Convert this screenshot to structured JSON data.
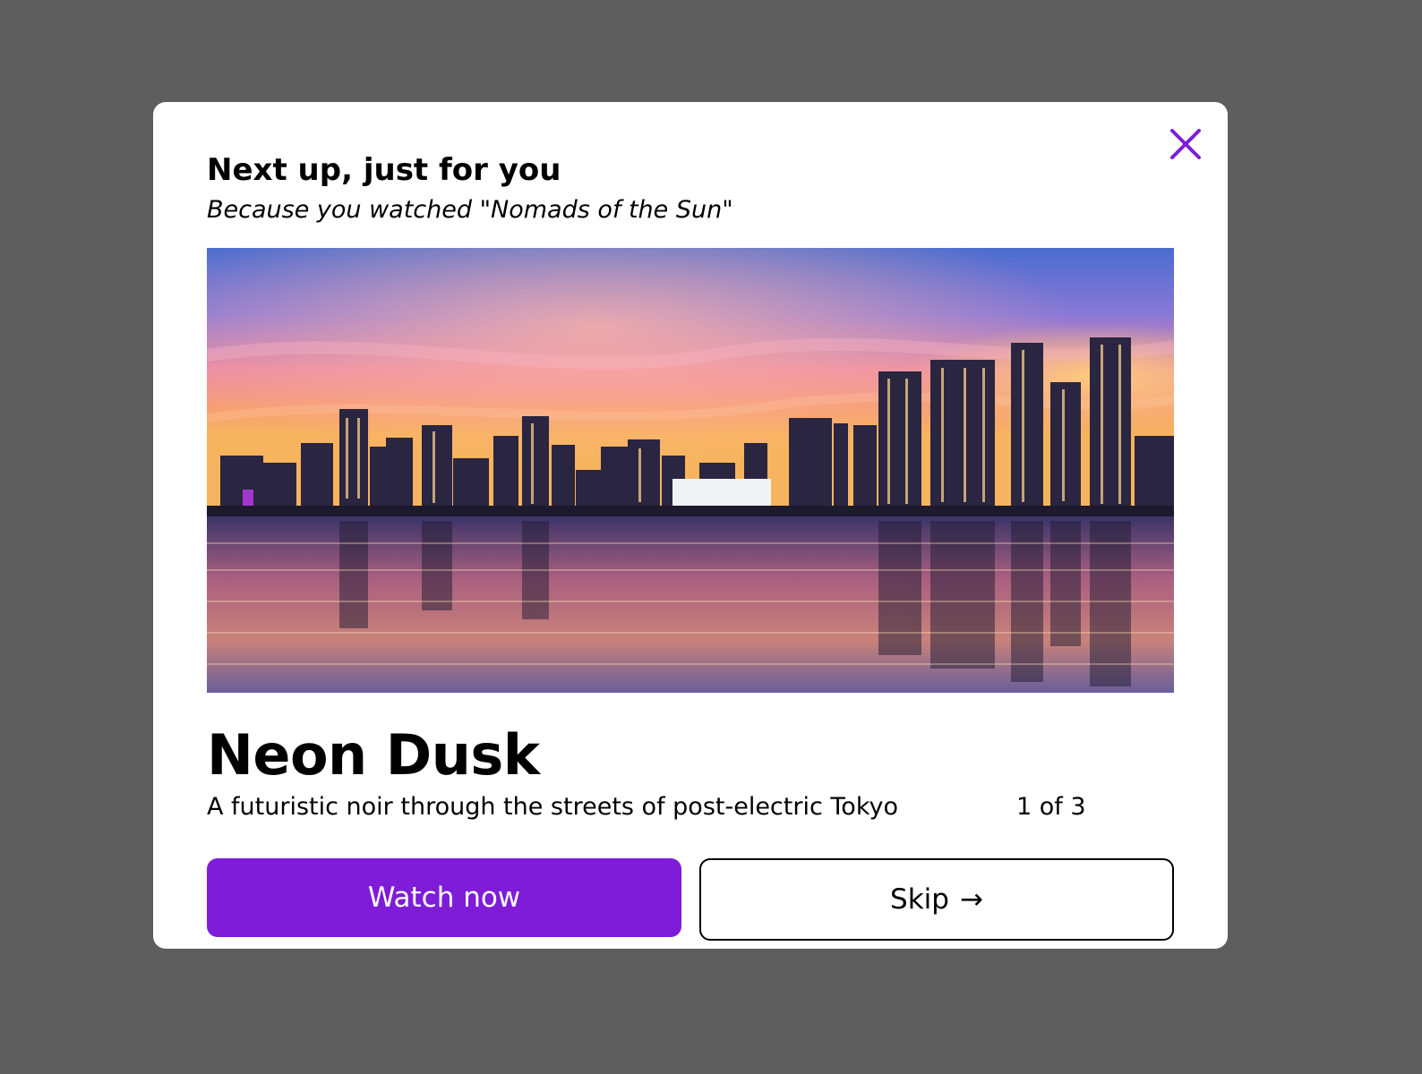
{
  "modal": {
    "heading": "Next up, just for you",
    "subheading": "Because you watched \"Nomads of the Sun\"",
    "close_icon": "close-icon",
    "accent_color": "#7e1cd8"
  },
  "recommendation": {
    "title": "Neon Dusk",
    "description": "A futuristic noir through the streets of post-electric Tokyo",
    "position": "1 of 3"
  },
  "actions": {
    "primary_label": "Watch now",
    "secondary_label": "Skip",
    "secondary_icon": "arrow-right-icon",
    "secondary_arrow": "→"
  }
}
